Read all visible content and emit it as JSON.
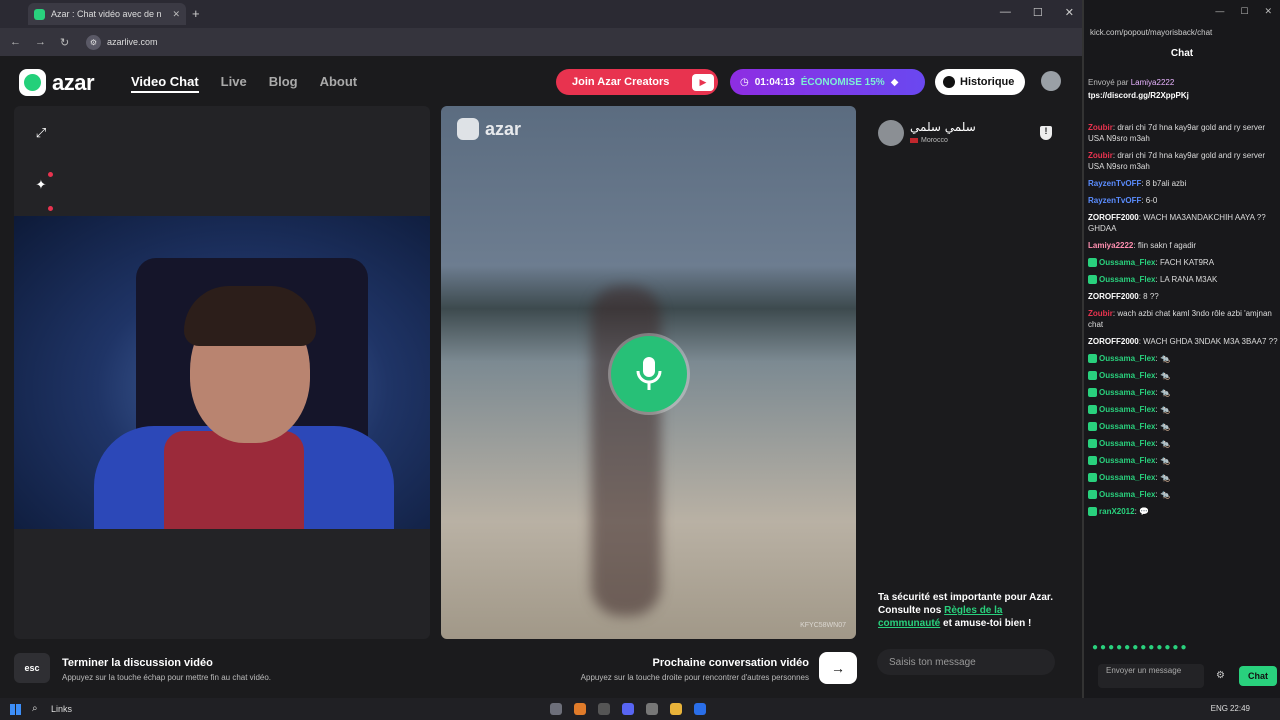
{
  "browser": {
    "tab_title": "Azar : Chat vidéo avec de n",
    "url": "azarlive.com"
  },
  "site": {
    "logo_text": "azar",
    "nav": [
      "Video Chat",
      "Live",
      "Blog",
      "About"
    ],
    "creators_button": "Join Azar Creators",
    "promo_timer": "01:04:13",
    "promo_text": "ÉCONOMISE 15%",
    "history_button": "Historique"
  },
  "peer": {
    "watermark": "azar",
    "name": "سلمي سلمي",
    "country": "Morocco",
    "id": "KFYC58WN07"
  },
  "safety": {
    "text1": "Ta sécurité est importante pour Azar. Consulte nos ",
    "link": "Règles de la communauté",
    "text2": " et amuse-toi bien !"
  },
  "bottom": {
    "esc_key": "esc",
    "end_title": "Terminer la discussion vidéo",
    "end_hint": "Appuyez sur la touche échap pour mettre fin au chat vidéo.",
    "next_title": "Prochaine conversation vidéo",
    "next_hint": "Appuyez sur la touche droite pour rencontrer d'autres personnes",
    "message_placeholder": "Saisis ton message"
  },
  "chat": {
    "url": "kick.com/popout/mayorisback/chat",
    "title": "Chat",
    "pinned_by": "Envoyé par",
    "pinned_user": "Lamiya2222",
    "pinned_link": "tps://discord.gg/R2XppPKj",
    "messages": [
      {
        "user": "Zoubir",
        "color": "#e8334f",
        "text": "drari chi 7d hna kay9ar gold and ry server USA N9sro m3ah"
      },
      {
        "user": "Zoubir",
        "color": "#e8334f",
        "text": "drari chi 7d hna kay9ar gold and ry server USA N9sro m3ah"
      },
      {
        "user": "RayzenTvOFF",
        "color": "#5b8dff",
        "text": "8 b7ali azbi"
      },
      {
        "user": "RayzenTvOFF",
        "color": "#5b8dff",
        "text": "6-0"
      },
      {
        "user": "ZOROFF2000",
        "color": "#ffffff",
        "text": "WACH MA3ANDAKCHIH AAYA ?? GHDAA"
      },
      {
        "user": "Lamiya2222",
        "color": "#ff8fb0",
        "text": "flin sakn f agadir"
      },
      {
        "user": "Oussama_Flex",
        "color": "#29d17d",
        "text": "FACH KAT9RA"
      },
      {
        "user": "Oussama_Flex",
        "color": "#29d17d",
        "text": "LA RANA M3AK"
      },
      {
        "user": "ZOROFF2000",
        "color": "#ffffff",
        "text": "8 ??"
      },
      {
        "user": "Zoubir",
        "color": "#e8334f",
        "text": "wach azbi chat kaml 3ndo rôle azbi 'amjnan chat"
      },
      {
        "user": "ZOROFF2000",
        "color": "#ffffff",
        "text": "WACH GHDA 3NDAK M3A 3BAA7 ??"
      },
      {
        "user": "Oussama_Flex",
        "color": "#29d17d",
        "text": "🐀"
      },
      {
        "user": "Oussama_Flex",
        "color": "#29d17d",
        "text": "🐀"
      },
      {
        "user": "Oussama_Flex",
        "color": "#29d17d",
        "text": "🐀"
      },
      {
        "user": "Oussama_Flex",
        "color": "#29d17d",
        "text": "🐀"
      },
      {
        "user": "Oussama_Flex",
        "color": "#29d17d",
        "text": "🐀"
      },
      {
        "user": "Oussama_Flex",
        "color": "#29d17d",
        "text": "🐀"
      },
      {
        "user": "Oussama_Flex",
        "color": "#29d17d",
        "text": "🐀"
      },
      {
        "user": "Oussama_Flex",
        "color": "#29d17d",
        "text": "🐀"
      },
      {
        "user": "Oussama_Flex",
        "color": "#29d17d",
        "text": "🐀"
      },
      {
        "user": "ranX2012",
        "color": "#29d17d",
        "text": "💬"
      }
    ],
    "input_placeholder": "Envoyer un message",
    "send_label": "Chat"
  },
  "taskbar": {
    "links_label": "Links",
    "lang": "ENG",
    "time": "22:49"
  },
  "colors": {
    "accent_green": "#29d17d",
    "creators_red": "#e8334f",
    "promo_purple": "#8e2de2"
  }
}
